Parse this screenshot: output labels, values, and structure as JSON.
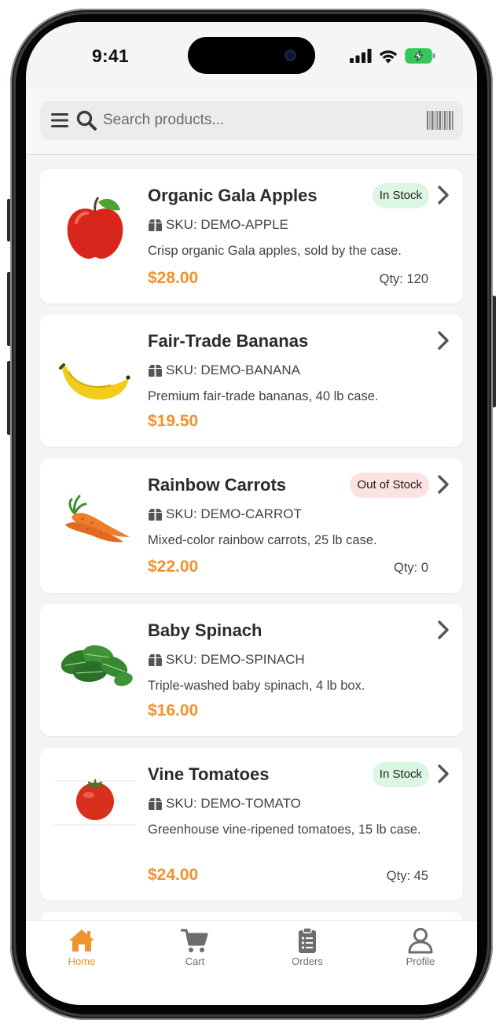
{
  "status_bar": {
    "time": "9:41",
    "battery_color": "#34c759"
  },
  "search": {
    "placeholder": "Search products..."
  },
  "products": [
    {
      "name": "Organic Gala Apples",
      "stock_status": "In Stock",
      "sku": "SKU: DEMO-APPLE",
      "description": "Crisp organic Gala apples, sold by the case.",
      "price": "$28.00",
      "qty": "Qty: 120",
      "image": "apple"
    },
    {
      "name": "Fair-Trade Bananas",
      "stock_status": "",
      "sku": "SKU: DEMO-BANANA",
      "description": "Premium fair-trade bananas, 40 lb case.",
      "price": "$19.50",
      "qty": "",
      "image": "banana"
    },
    {
      "name": "Rainbow Carrots",
      "stock_status": "Out of Stock",
      "sku": "SKU: DEMO-CARROT",
      "description": "Mixed-color rainbow carrots, 25 lb case.",
      "price": "$22.00",
      "qty": "Qty: 0",
      "image": "carrot"
    },
    {
      "name": "Baby Spinach",
      "stock_status": "",
      "sku": "SKU: DEMO-SPINACH",
      "description": "Triple-washed baby spinach, 4 lb box.",
      "price": "$16.00",
      "qty": "",
      "image": "spinach"
    },
    {
      "name": "Vine Tomatoes",
      "stock_status": "In Stock",
      "sku": "SKU: DEMO-TOMATO",
      "description": "Greenhouse vine-ripened tomatoes, 15 lb case.",
      "price": "$24.00",
      "qty": "Qty: 45",
      "image": "tomato"
    }
  ],
  "tabs": [
    {
      "label": "Home",
      "icon": "home-icon",
      "active": true
    },
    {
      "label": "Cart",
      "icon": "cart-icon",
      "active": false
    },
    {
      "label": "Orders",
      "icon": "clipboard-icon",
      "active": false
    },
    {
      "label": "Profile",
      "icon": "person-icon",
      "active": false
    }
  ],
  "colors": {
    "accent": "#f0922d",
    "in_stock_bg": "#dcf6e4",
    "out_of_stock_bg": "#fde2e2"
  }
}
